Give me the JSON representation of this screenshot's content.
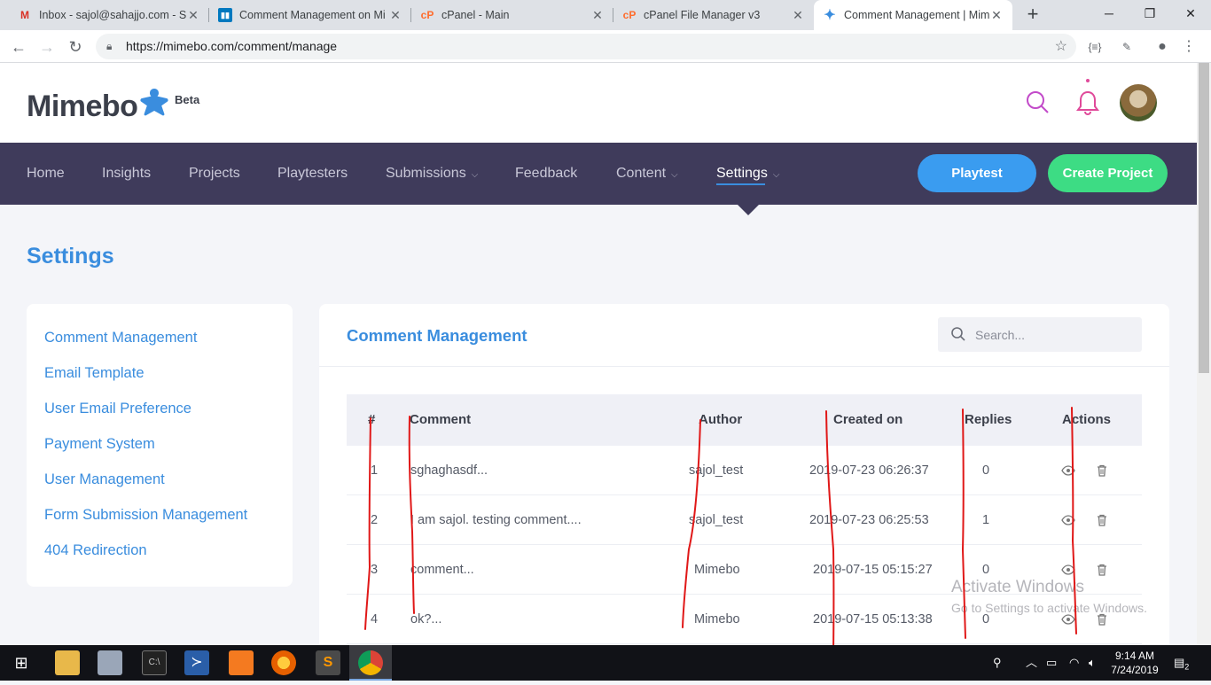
{
  "browser": {
    "tabs": [
      {
        "title": "Inbox - sajol@sahajjo.com - Sa",
        "icon": "gmail-icon",
        "color": "#d93025"
      },
      {
        "title": "Comment Management on Mi",
        "icon": "trello-icon",
        "color": "#0079bf"
      },
      {
        "title": "cPanel - Main",
        "icon": "cpanel-icon",
        "color": "#ff6c2c"
      },
      {
        "title": "cPanel File Manager v3",
        "icon": "cpanel-icon",
        "color": "#ff6c2c"
      },
      {
        "title": "Comment Management | Mim",
        "icon": "mimebo-icon",
        "color": "#3a8dde"
      }
    ],
    "url": "https://mimebo.com/comment/manage"
  },
  "site": {
    "logo": "Mimebo",
    "beta": "Beta",
    "nav": {
      "home": "Home",
      "insights": "Insights",
      "projects": "Projects",
      "playtesters": "Playtesters",
      "submissions": "Submissions",
      "feedback": "Feedback",
      "content": "Content",
      "settings": "Settings"
    },
    "buttons": {
      "playtest": "Playtest",
      "create_project": "Create Project"
    },
    "colors": {
      "accent": "#3a8dde",
      "nav_bg": "#3f3b5b",
      "playtest": "#3a9cf0",
      "create": "#3ddc84"
    }
  },
  "settings": {
    "title": "Settings",
    "menu": [
      "Comment Management",
      "Email Template",
      "User Email Preference",
      "Payment System",
      "User Management",
      "Form Submission Management",
      "404 Redirection"
    ]
  },
  "comments": {
    "title": "Comment Management",
    "search_placeholder": "Search...",
    "headers": {
      "num": "#",
      "comment": "Comment",
      "author": "Author",
      "created": "Created on",
      "replies": "Replies",
      "actions": "Actions"
    },
    "rows": [
      {
        "num": "1",
        "comment": "sghaghasdf...",
        "author": "sajol_test",
        "created": "2019-07-23 06:26:37",
        "replies": "0"
      },
      {
        "num": "2",
        "comment": "I am sajol. testing comment....",
        "author": "sajol_test",
        "created": "2019-07-23 06:25:53",
        "replies": "1"
      },
      {
        "num": "3",
        "comment": "comment...",
        "author": "Mimebo",
        "created": "2019-07-15 05:15:27",
        "replies": "0"
      },
      {
        "num": "4",
        "comment": "ok?...",
        "author": "Mimebo",
        "created": "2019-07-15 05:13:38",
        "replies": "0"
      }
    ]
  },
  "watermark": {
    "line1": "Activate Windows",
    "line2": "Go to Settings to activate Windows."
  },
  "taskbar": {
    "time": "9:14 AM",
    "date": "7/24/2019",
    "notifications": "2"
  }
}
